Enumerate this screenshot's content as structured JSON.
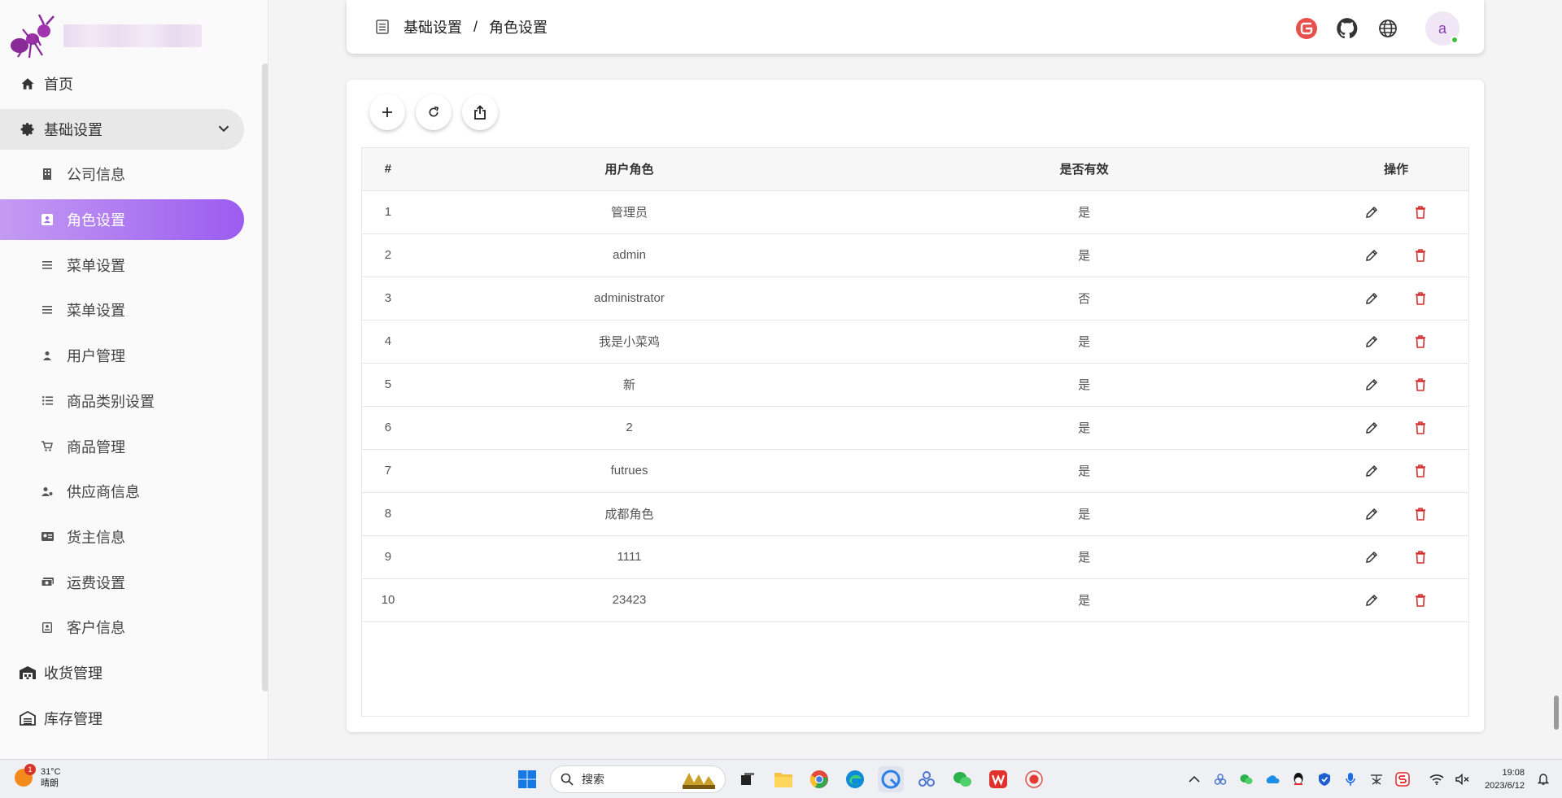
{
  "sidebar": {
    "items": [
      {
        "label": "首页",
        "icon": "home-icon",
        "level": "top"
      },
      {
        "label": "基础设置",
        "icon": "gear-icon",
        "level": "group"
      },
      {
        "label": "公司信息",
        "icon": "building-icon",
        "level": "sub"
      },
      {
        "label": "角色设置",
        "icon": "badge-icon",
        "level": "active"
      },
      {
        "label": "菜单设置",
        "icon": "menu-lines-icon",
        "level": "sub"
      },
      {
        "label": "菜单设置",
        "icon": "menu-lines-icon",
        "level": "sub"
      },
      {
        "label": "用户管理",
        "icon": "person-icon",
        "level": "sub"
      },
      {
        "label": "商品类别设置",
        "icon": "list-icon",
        "level": "sub"
      },
      {
        "label": "商品管理",
        "icon": "cart-icon",
        "level": "sub"
      },
      {
        "label": "供应商信息",
        "icon": "person-gear-icon",
        "level": "sub"
      },
      {
        "label": "货主信息",
        "icon": "id-card-icon",
        "level": "sub"
      },
      {
        "label": "运费设置",
        "icon": "money-icon",
        "level": "sub"
      },
      {
        "label": "客户信息",
        "icon": "contact-icon",
        "level": "sub"
      },
      {
        "label": "收货管理",
        "icon": "warehouse-icon",
        "level": "top"
      },
      {
        "label": "库存管理",
        "icon": "warehouse2-icon",
        "level": "top"
      }
    ]
  },
  "header": {
    "breadcrumb": [
      "基础设置",
      "角色设置"
    ],
    "separator": "/",
    "avatar_letter": "a"
  },
  "table": {
    "columns": [
      "#",
      "用户角色",
      "是否有效",
      "操作"
    ],
    "rows": [
      {
        "idx": "1",
        "role": "管理员",
        "valid": "是"
      },
      {
        "idx": "2",
        "role": "admin",
        "valid": "是"
      },
      {
        "idx": "3",
        "role": "administrator",
        "valid": "否"
      },
      {
        "idx": "4",
        "role": "我是小菜鸡",
        "valid": "是"
      },
      {
        "idx": "5",
        "role": "新",
        "valid": "是"
      },
      {
        "idx": "6",
        "role": "2",
        "valid": "是"
      },
      {
        "idx": "7",
        "role": "futrues",
        "valid": "是"
      },
      {
        "idx": "8",
        "role": "成都角色",
        "valid": "是"
      },
      {
        "idx": "9",
        "role": "1111",
        "valid": "是"
      },
      {
        "idx": "10",
        "role": "23423",
        "valid": "是"
      }
    ]
  },
  "taskbar": {
    "weather_temp": "31°C",
    "weather_desc": "晴朗",
    "weather_badge": "1",
    "search_placeholder": "搜索",
    "time": "19:08",
    "date": "2023/6/12"
  },
  "colors": {
    "accent": "#9b5cf0",
    "delete": "#d32f2f",
    "edit": "#333333"
  }
}
